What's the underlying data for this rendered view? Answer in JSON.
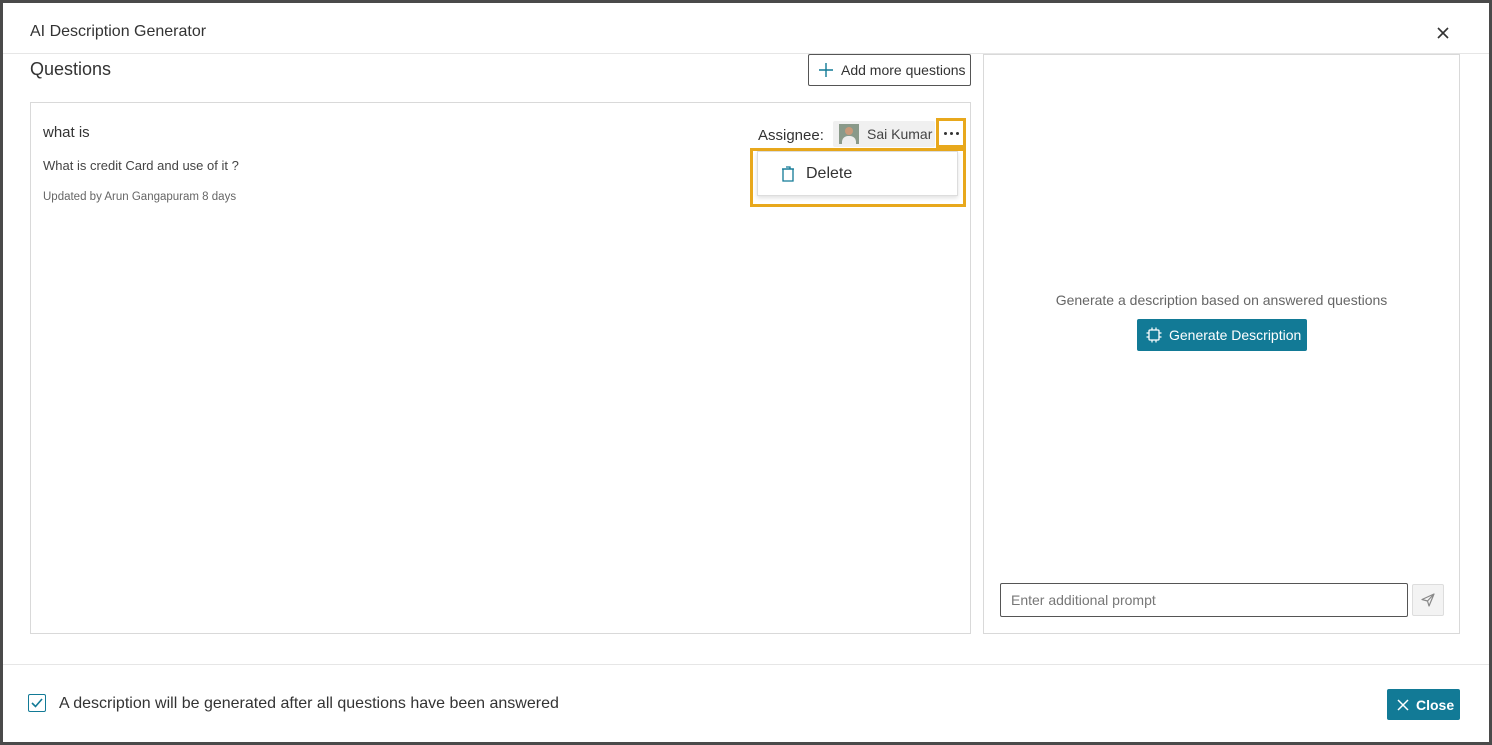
{
  "dialog": {
    "title": "AI Description Generator"
  },
  "questions": {
    "heading": "Questions",
    "add_button_label": "Add more questions",
    "items": [
      {
        "title": "what is",
        "description": "What is credit Card and use of it ?",
        "updated": "Updated by Arun Gangapuram 8 days",
        "assignee_label": "Assignee:",
        "assignee_name": "Sai Kumar"
      }
    ],
    "context_menu": {
      "items": [
        {
          "label": "Delete",
          "icon": "trash-icon"
        }
      ]
    }
  },
  "generator": {
    "hint": "Generate a description based on answered questions",
    "button_label": "Generate Description",
    "prompt_placeholder": "Enter additional prompt",
    "prompt_value": ""
  },
  "footer": {
    "checkbox_checked": true,
    "checkbox_label": "A description will be generated after all questions have been answered",
    "close_label": "Close"
  },
  "colors": {
    "accent": "#127a96",
    "highlight": "#e8a81c"
  }
}
